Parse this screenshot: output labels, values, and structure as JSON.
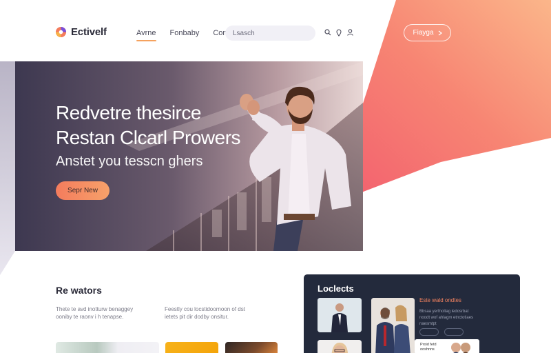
{
  "brand": {
    "name": "Ectivelf"
  },
  "nav": {
    "items": [
      {
        "label": "Avrne",
        "active": true
      },
      {
        "label": "Fonbaby",
        "active": false
      },
      {
        "label": "Coniet",
        "active": false
      }
    ]
  },
  "search": {
    "placeholder": "Lsasch"
  },
  "header_cta": {
    "label": "Fiayga"
  },
  "hero": {
    "title_line1": "Redvetre thesirce",
    "title_line2": "Restan Clcarl Prowers",
    "subtitle": "Anstet you tesscn ghers",
    "button_label": "Sepr New"
  },
  "reviews": {
    "title": "Re wators",
    "col1_line1": "Thete te avd inotturw benaggey",
    "col1_line2": "ooniby te raonv i h tenapse.",
    "col2_line1": "Feestly cou locstidoornoon of dst",
    "col2_line2": "ietets pit dir dodby onsitur."
  },
  "locations": {
    "title": "Loclects",
    "accent_heading": "Este wald ondtes",
    "text_line1": "Bbsaa yerfnoltag ledosrbat",
    "text_line2": "noodt wof ahlagm etnctotiaes",
    "text_line3": "naesmtpt",
    "card_label": "Proid fetd ooshnns"
  },
  "colors": {
    "accent_orange": "#f5a25e",
    "gradient_start": "#f25b6e",
    "gradient_end": "#fbb68a",
    "dark_card": "#232a3c"
  }
}
